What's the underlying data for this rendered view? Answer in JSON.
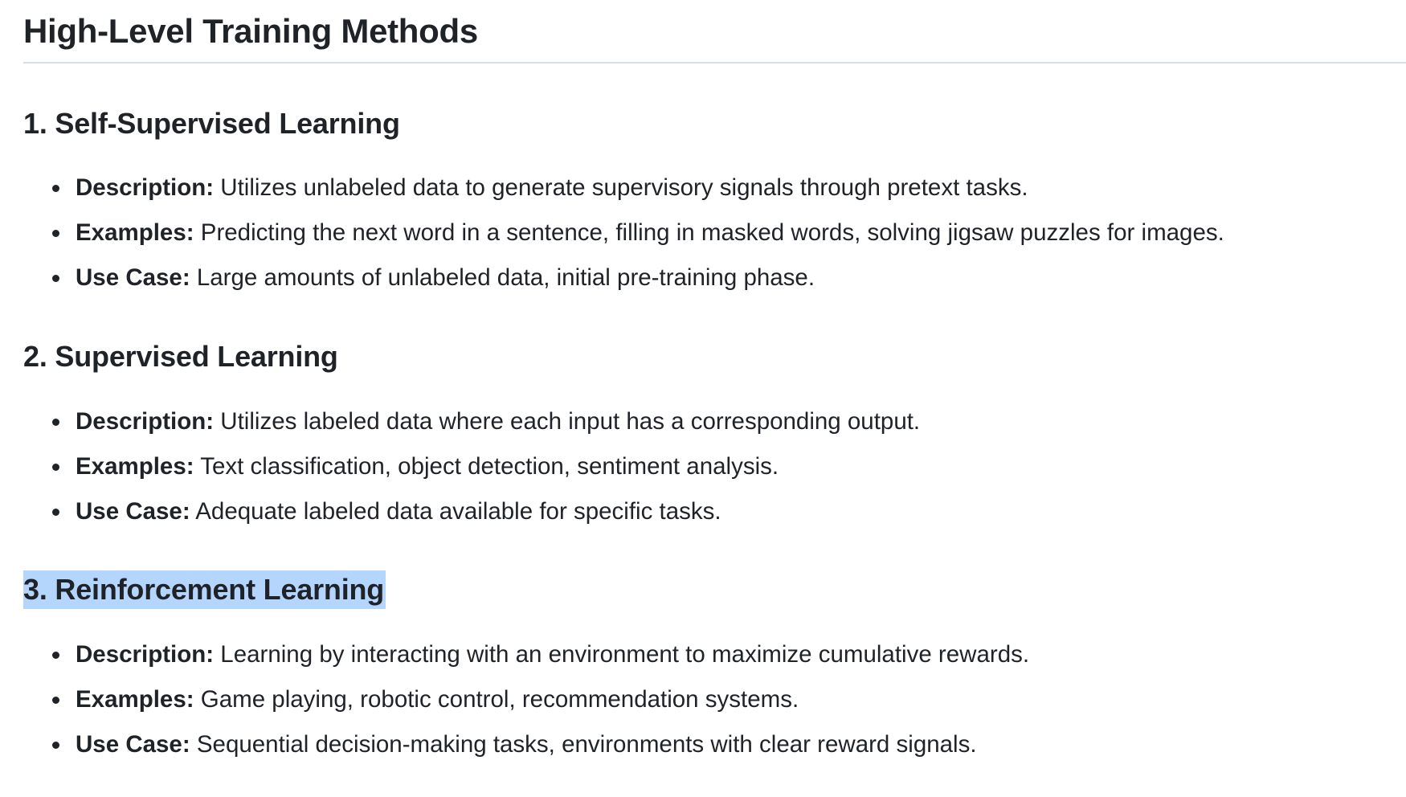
{
  "title": "High-Level Training Methods",
  "sections": [
    {
      "heading": "1. Self-Supervised Learning",
      "items": [
        {
          "label": "Description:",
          "text": " Utilizes unlabeled data to generate supervisory signals through pretext tasks."
        },
        {
          "label": "Examples:",
          "text": " Predicting the next word in a sentence, filling in masked words, solving jigsaw puzzles for images."
        },
        {
          "label": "Use Case:",
          "text": " Large amounts of unlabeled data, initial pre-training phase."
        }
      ]
    },
    {
      "heading": "2. Supervised Learning",
      "items": [
        {
          "label": "Description:",
          "text": " Utilizes labeled data where each input has a corresponding output."
        },
        {
          "label": "Examples:",
          "text": " Text classification, object detection, sentiment analysis."
        },
        {
          "label": "Use Case:",
          "text": " Adequate labeled data available for specific tasks."
        }
      ]
    },
    {
      "heading": "3. Reinforcement Learning",
      "selected": true,
      "items": [
        {
          "label": "Description:",
          "text": " Learning by interacting with an environment to maximize cumulative rewards."
        },
        {
          "label": "Examples:",
          "text": " Game playing, robotic control, recommendation systems."
        },
        {
          "label": "Use Case:",
          "text": " Sequential decision-making tasks, environments with clear reward signals."
        }
      ]
    }
  ],
  "colors": {
    "text": "#1f2328",
    "selection": "#b4d5fe",
    "divider": "#d8dee4"
  }
}
